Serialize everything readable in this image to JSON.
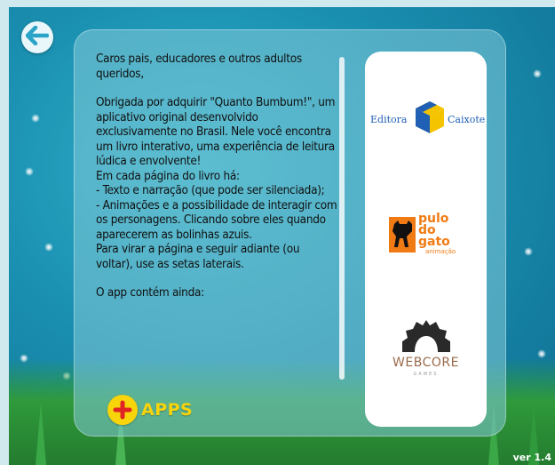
{
  "intro": {
    "greeting": "Caros pais, educadores e outros adultos queridos,",
    "paragraph": "Obrigada por adquirir \"Quanto Bumbum!\", um aplicativo original desenvolvido exclusivamente no Brasil. Nele você encontra um livro interativo, uma experiência de leitura lúdica e envolvente!",
    "features_intro": "Em cada página do livro há:",
    "feature_1": "- Texto e narração (que pode ser silenciada);",
    "feature_2": "- Animações e a possibilidade de interagir com os personagens. Clicando sobre eles quando aparecerem as bolinhas azuis.",
    "navigation": "Para virar a página e seguir adiante (ou voltar), use as setas laterais.",
    "contains": "O app contém ainda:"
  },
  "apps_button": {
    "label": "APPS"
  },
  "logos": {
    "editora": {
      "left": "Editora",
      "right": "Caixote"
    },
    "pulo": {
      "line1": "pulo",
      "line2": "do",
      "line3": "gato",
      "line4": "animação"
    },
    "webcore": {
      "name": "WEBCORE",
      "sub": "GAMES"
    }
  },
  "version": "ver 1.4",
  "icons": {
    "back": "arrow-left-icon",
    "plus": "plus-icon"
  },
  "colors": {
    "background": "#1a8fb0",
    "accent_yellow": "#f8d40b",
    "editora_blue": "#1f5fb4",
    "pulo_orange": "#f07b14",
    "webcore_dark": "#3a3a3a"
  }
}
